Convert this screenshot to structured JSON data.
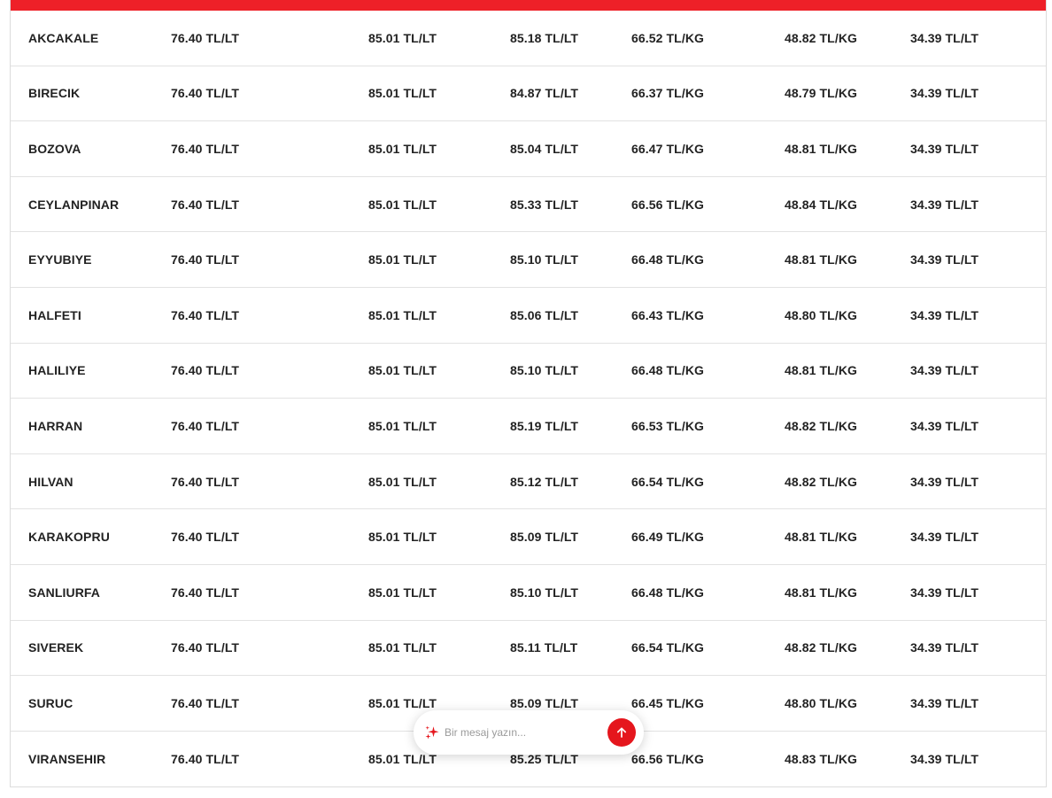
{
  "theme": {
    "accent": "#ee2028",
    "send_button": "#e5161d"
  },
  "rows": [
    [
      "AKCAKALE",
      "76.40 TL/LT",
      "85.01 TL/LT",
      "85.18 TL/LT",
      "66.52 TL/KG",
      "48.82 TL/KG",
      "34.39 TL/LT"
    ],
    [
      "BIRECIK",
      "76.40 TL/LT",
      "85.01 TL/LT",
      "84.87 TL/LT",
      "66.37 TL/KG",
      "48.79 TL/KG",
      "34.39 TL/LT"
    ],
    [
      "BOZOVA",
      "76.40 TL/LT",
      "85.01 TL/LT",
      "85.04 TL/LT",
      "66.47 TL/KG",
      "48.81 TL/KG",
      "34.39 TL/LT"
    ],
    [
      "CEYLANPINAR",
      "76.40 TL/LT",
      "85.01 TL/LT",
      "85.33 TL/LT",
      "66.56 TL/KG",
      "48.84 TL/KG",
      "34.39 TL/LT"
    ],
    [
      "EYYUBIYE",
      "76.40 TL/LT",
      "85.01 TL/LT",
      "85.10 TL/LT",
      "66.48 TL/KG",
      "48.81 TL/KG",
      "34.39 TL/LT"
    ],
    [
      "HALFETI",
      "76.40 TL/LT",
      "85.01 TL/LT",
      "85.06 TL/LT",
      "66.43 TL/KG",
      "48.80 TL/KG",
      "34.39 TL/LT"
    ],
    [
      "HALILIYE",
      "76.40 TL/LT",
      "85.01 TL/LT",
      "85.10 TL/LT",
      "66.48 TL/KG",
      "48.81 TL/KG",
      "34.39 TL/LT"
    ],
    [
      "HARRAN",
      "76.40 TL/LT",
      "85.01 TL/LT",
      "85.19 TL/LT",
      "66.53 TL/KG",
      "48.82 TL/KG",
      "34.39 TL/LT"
    ],
    [
      "HILVAN",
      "76.40 TL/LT",
      "85.01 TL/LT",
      "85.12 TL/LT",
      "66.54 TL/KG",
      "48.82 TL/KG",
      "34.39 TL/LT"
    ],
    [
      "KARAKOPRU",
      "76.40 TL/LT",
      "85.01 TL/LT",
      "85.09 TL/LT",
      "66.49 TL/KG",
      "48.81 TL/KG",
      "34.39 TL/LT"
    ],
    [
      "SANLIURFA",
      "76.40 TL/LT",
      "85.01 TL/LT",
      "85.10 TL/LT",
      "66.48 TL/KG",
      "48.81 TL/KG",
      "34.39 TL/LT"
    ],
    [
      "SIVEREK",
      "76.40 TL/LT",
      "85.01 TL/LT",
      "85.11 TL/LT",
      "66.54 TL/KG",
      "48.82 TL/KG",
      "34.39 TL/LT"
    ],
    [
      "SURUC",
      "76.40 TL/LT",
      "85.01 TL/LT",
      "85.09 TL/LT",
      "66.45 TL/KG",
      "48.80 TL/KG",
      "34.39 TL/LT"
    ],
    [
      "VIRANSEHIR",
      "76.40 TL/LT",
      "85.01 TL/LT",
      "85.25 TL/LT",
      "66.56 TL/KG",
      "48.83 TL/KG",
      "34.39 TL/LT"
    ]
  ],
  "chat": {
    "placeholder": "Bir mesaj yazın...",
    "icon": "sparkle-icon",
    "send_icon": "arrow-up-icon"
  }
}
